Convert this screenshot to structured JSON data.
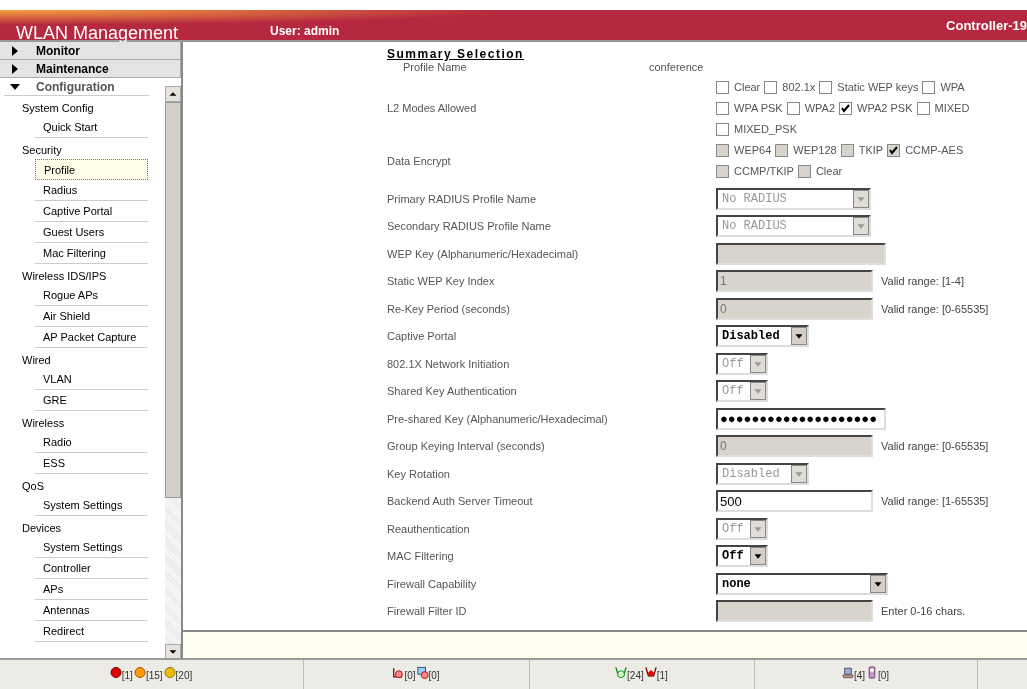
{
  "header": {
    "title": "WLAN Management",
    "user": "User: admin",
    "controller": "Controller-19"
  },
  "nav": {
    "sections": [
      {
        "label": "Monitor",
        "expanded": false
      },
      {
        "label": "Maintenance",
        "expanded": false
      },
      {
        "label": "Configuration",
        "expanded": true
      }
    ],
    "groups": [
      {
        "label": "System Config",
        "items": [
          {
            "label": "Quick Start",
            "selected": false
          }
        ]
      },
      {
        "label": "Security",
        "items": [
          {
            "label": "Profile",
            "selected": true
          },
          {
            "label": "Radius",
            "selected": false
          },
          {
            "label": "Captive Portal",
            "selected": false
          },
          {
            "label": "Guest Users",
            "selected": false
          },
          {
            "label": "Mac Filtering",
            "selected": false
          }
        ]
      },
      {
        "label": "Wireless IDS/IPS",
        "items": [
          {
            "label": "Rogue APs",
            "selected": false
          },
          {
            "label": "Air Shield",
            "selected": false
          },
          {
            "label": "AP Packet Capture",
            "selected": false
          }
        ]
      },
      {
        "label": "Wired",
        "items": [
          {
            "label": "VLAN",
            "selected": false
          },
          {
            "label": "GRE",
            "selected": false
          }
        ]
      },
      {
        "label": "Wireless",
        "items": [
          {
            "label": "Radio",
            "selected": false
          },
          {
            "label": "ESS",
            "selected": false
          }
        ]
      },
      {
        "label": "QoS",
        "items": [
          {
            "label": "System Settings",
            "selected": false
          }
        ]
      },
      {
        "label": "Devices",
        "items": [
          {
            "label": "System Settings",
            "selected": false
          },
          {
            "label": "Controller",
            "selected": false
          },
          {
            "label": "APs",
            "selected": false
          },
          {
            "label": "Antennas",
            "selected": false
          },
          {
            "label": "Redirect",
            "selected": false
          }
        ]
      }
    ]
  },
  "form": {
    "heading": "Summary Selection",
    "profile_name": {
      "label": "Profile Name",
      "value": "conference"
    },
    "checkbox_groups": [
      {
        "label": "L2 Modes Allowed",
        "options": [
          {
            "label": "Clear",
            "checked": false,
            "disabled": false
          },
          {
            "label": "802.1x",
            "checked": false,
            "disabled": false
          },
          {
            "label": "Static WEP keys",
            "checked": false,
            "disabled": false
          },
          {
            "label": "WPA",
            "checked": false,
            "disabled": false
          },
          {
            "label": "WPA PSK",
            "checked": false,
            "disabled": false
          },
          {
            "label": "WPA2",
            "checked": false,
            "disabled": false
          },
          {
            "label": "WPA2 PSK",
            "checked": true,
            "disabled": false
          },
          {
            "label": "MIXED",
            "checked": false,
            "disabled": false
          },
          {
            "label": "MIXED_PSK",
            "checked": false,
            "disabled": false
          }
        ]
      },
      {
        "label": "Data Encrypt",
        "options": [
          {
            "label": "WEP64",
            "checked": false,
            "disabled": true
          },
          {
            "label": "WEP128",
            "checked": false,
            "disabled": true
          },
          {
            "label": "TKIP",
            "checked": false,
            "disabled": true
          },
          {
            "label": "CCMP-AES",
            "checked": true,
            "disabled": true
          },
          {
            "label": "CCMP/TKIP",
            "checked": false,
            "disabled": true
          },
          {
            "label": "Clear",
            "checked": false,
            "disabled": true
          }
        ]
      }
    ],
    "fields": [
      {
        "label": "Primary RADIUS Profile Name",
        "kind": "select",
        "value": "No RADIUS",
        "disabled": true
      },
      {
        "label": "Secondary RADIUS Profile Name",
        "kind": "select",
        "value": "No RADIUS",
        "disabled": true
      },
      {
        "label": "WEP Key (Alphanumeric/Hexadecimal)",
        "kind": "text",
        "disabled": true
      },
      {
        "label": "Static WEP Key Index",
        "kind": "text",
        "value": "1",
        "disabled": true,
        "hint": "Valid range: [1-4]"
      },
      {
        "label": "Re-Key Period (seconds)",
        "kind": "text",
        "value": "0",
        "disabled": true,
        "hint": "Valid range: [0-65535]"
      },
      {
        "label": "Captive Portal",
        "kind": "select",
        "value": "Disabled",
        "disabled": false
      },
      {
        "label": "802.1X Network Initiation",
        "kind": "select",
        "value": "Off",
        "disabled": true
      },
      {
        "label": "Shared Key Authentication",
        "kind": "select",
        "value": "Off",
        "disabled": true
      },
      {
        "label": "Pre-shared Key (Alphanumeric/Hexadecimal)",
        "kind": "text",
        "value": "●●●●●●●●●●●●●●●●●●●●",
        "disabled": false
      },
      {
        "label": "Group Keying Interval (seconds)",
        "kind": "text",
        "value": "0",
        "disabled": true,
        "hint": "Valid range: [0-65535]"
      },
      {
        "label": "Key Rotation",
        "kind": "select",
        "value": "Disabled",
        "disabled": true
      },
      {
        "label": "Backend Auth Server Timeout",
        "kind": "text",
        "value": "500",
        "disabled": false,
        "hint": "Valid range: [1-65535]"
      },
      {
        "label": "Reauthentication",
        "kind": "select",
        "value": "Off",
        "disabled": true
      },
      {
        "label": "MAC Filtering",
        "kind": "select",
        "value": "Off",
        "disabled": false
      },
      {
        "label": "Firewall Capability",
        "kind": "select",
        "value": "none",
        "disabled": false
      },
      {
        "label": "Firewall Filter ID",
        "kind": "text",
        "disabled": true,
        "hint": "Enter 0-16 chars."
      }
    ]
  },
  "status_bar": [
    {
      "items": [
        {
          "kind": "red-dot",
          "count": "[1]"
        },
        {
          "kind": "orange-dot",
          "count": "[15]"
        },
        {
          "kind": "yellow-dot",
          "count": "[20]"
        }
      ]
    },
    {
      "items": [
        {
          "kind": "alert-ap",
          "count": "[0]"
        },
        {
          "kind": "alert-monitor",
          "count": "[0]"
        }
      ]
    },
    {
      "items": [
        {
          "kind": "ap-ok",
          "count": "[24]"
        },
        {
          "kind": "ap-down",
          "count": "[1]"
        }
      ]
    },
    {
      "items": [
        {
          "kind": "laptop",
          "count": "[4]"
        },
        {
          "kind": "phone",
          "count": "[0]"
        }
      ]
    }
  ]
}
